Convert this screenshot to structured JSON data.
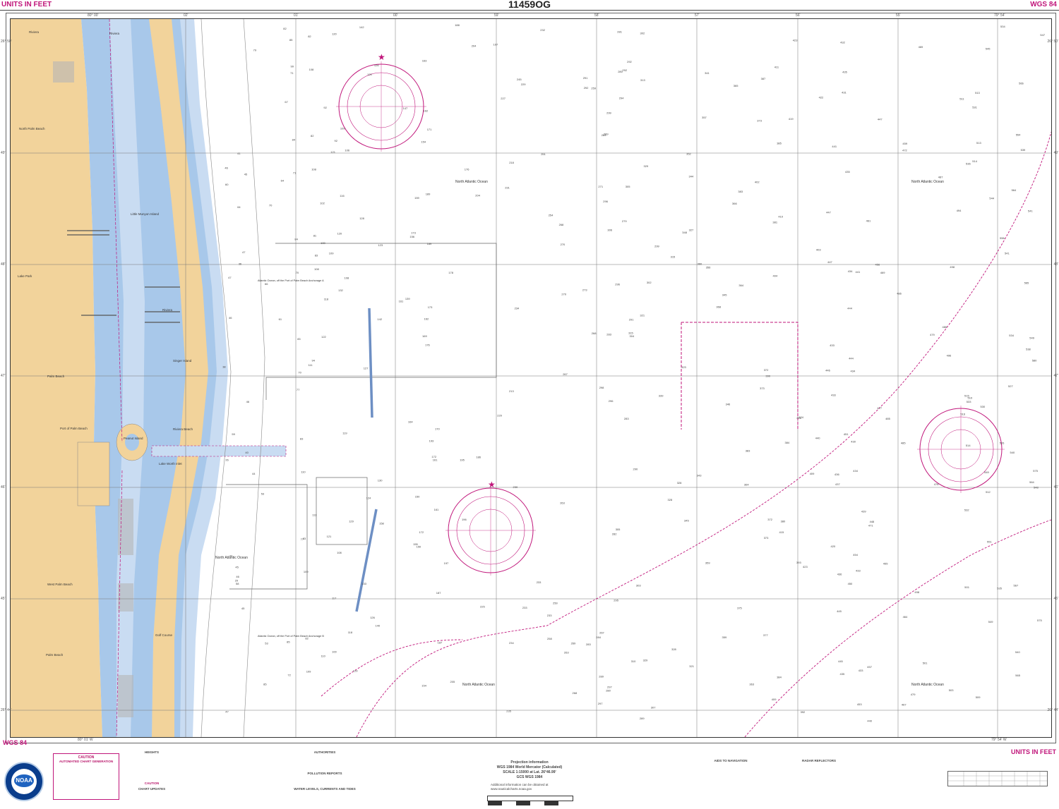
{
  "header": {
    "units_left": "UNITS IN FEET",
    "chart_number": "11459OG",
    "datum_right": "WGS 84"
  },
  "footer": {
    "datum_left": "WGS 84",
    "units_right": "UNITS IN FEET",
    "lon_left": "80° 01' W",
    "lon_right": "79° 54' W",
    "projection_title": "Projection information",
    "projection_line1": "WGS 1984 World Mercator (Calculated)",
    "projection_line2": "SCALE 1:15000 at Lat. 26°46.99'",
    "projection_line3": "GCS WGS 1984",
    "additional_info": "Additional information can be obtained at www.nauticalcharts.noaa.gov"
  },
  "notes": {
    "caution_title": "CAUTION",
    "caution_subtitle": "AUTOMATED CHART GENERATION",
    "heights_title": "HEIGHTS",
    "authorities_title": "AUTHORITIES",
    "pollution_title": "POLLUTION REPORTS",
    "currents_title": "WATER LEVELS, CURRENTS AND TIDES",
    "aids_title": "AIDS TO NAVIGATION",
    "radar_title": "RADAR REFLECTORS",
    "caution2_title": "CAUTION",
    "chart_updates_title": "CHART UPDATES"
  },
  "place_names": {
    "ocean": "North Atlantic Ocean",
    "riviera": "Riviera",
    "riviera_beach": "Riviera Beach",
    "north_palm_beach": "North Palm Beach",
    "palm_beach": "Palm Beach",
    "west_palm_beach": "West Palm Beach",
    "lake_park": "Lake Park",
    "peanut_island": "Peanut Island",
    "singer_island": "Singer Island",
    "port_of_palm_beach": "Port of Palm Beach",
    "little_munyon_island": "Little Munyon Island",
    "lake_worth_inlet": "Lake Worth Inlet",
    "golf_course": "Golf Course",
    "anchorage_a": "Atlantic Ocean, off the Port of Palm Beach Anchorage A",
    "anchorage_b": "Atlantic Ocean, off the Port of Palm Beach Anchorage B"
  },
  "lat_labels": [
    "26° 50'",
    "49'",
    "48'",
    "47'",
    "46'",
    "45'",
    "26° 44'"
  ],
  "lon_labels": [
    "80° 00'",
    "02'",
    "01'",
    "00'",
    "59'",
    "58'",
    "57'",
    "56'",
    "55'",
    "79° 54'"
  ],
  "colors": {
    "land": "#f2d39b",
    "deep_water": "#ffffff",
    "shallow_water": "#a8c8ea",
    "mid_water": "#c9dcf2",
    "magenta": "#c0157a",
    "grid": "#777777"
  }
}
